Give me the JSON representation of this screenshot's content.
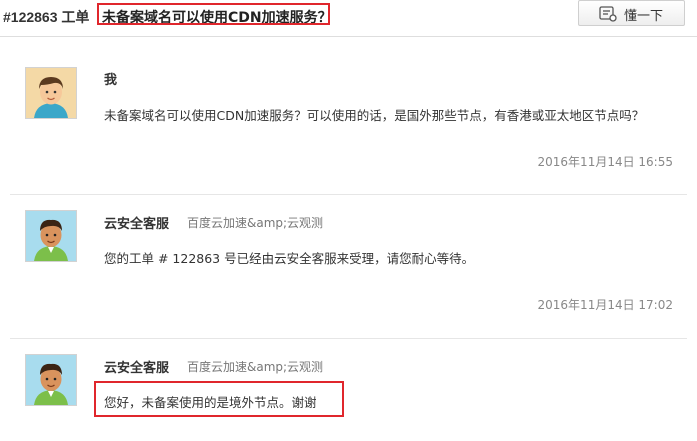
{
  "header": {
    "ticket_id": "#122863 工单",
    "ticket_title": "未备案域名可以使用CDN加速服务？",
    "understand_button": "懂一下"
  },
  "messages": [
    {
      "sender": "我",
      "service": "",
      "text": "未备案域名可以使用CDN加速服务？可以使用的话，是国外那些节点，有香港或亚太地区节点吗？",
      "time": "2016年11月14日 16:55"
    },
    {
      "sender": "云安全客服",
      "service": "百度云加速&amp;云观测",
      "text": "您的工单 # 122863 号已经由云安全客服来受理，请您耐心等待。",
      "time": "2016年11月14日 17:02"
    },
    {
      "sender": "云安全客服",
      "service": "百度云加速&amp;云观测",
      "text": "您好，未备案使用的是境外节点。谢谢",
      "time": ""
    }
  ],
  "icons": {
    "button_icon": "feedback-icon",
    "user_avatar": "user-avatar",
    "agent_avatar": "agent-avatar"
  },
  "colors": {
    "highlight": "#e0262c",
    "user_avatar_bg": "#f4d9a6",
    "agent_avatar_bg": "#a8dcee"
  }
}
